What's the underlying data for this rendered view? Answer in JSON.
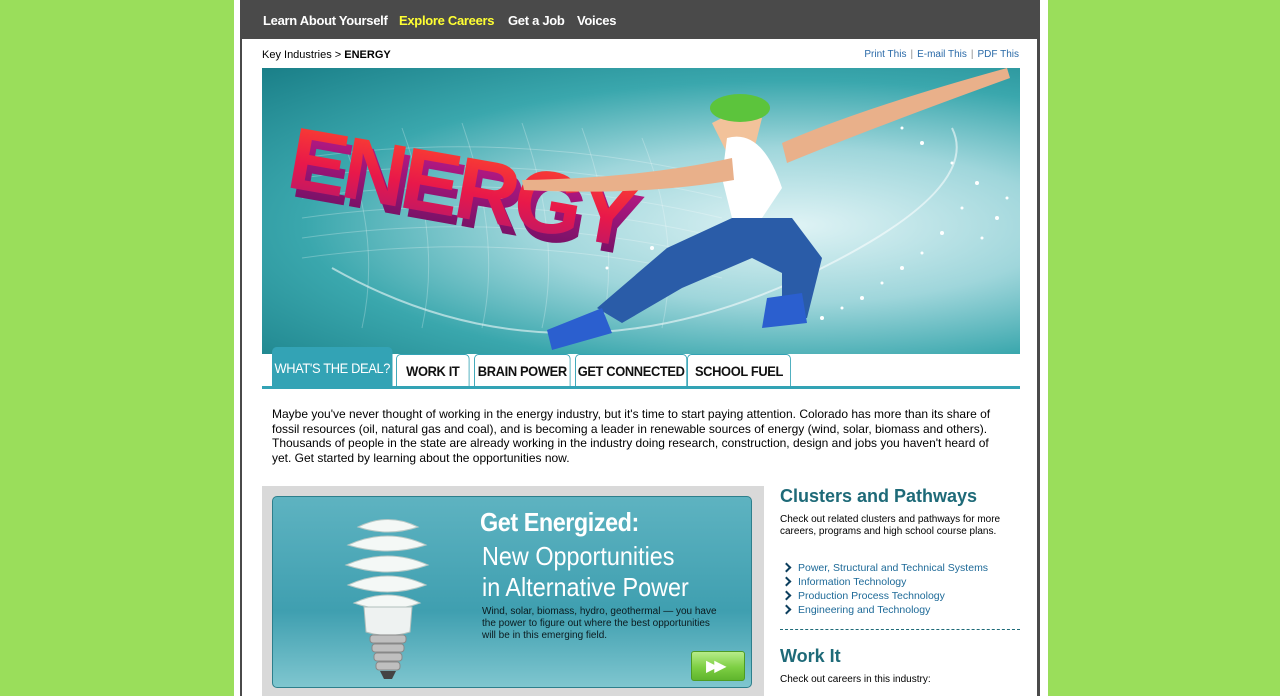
{
  "nav": {
    "items": [
      {
        "label": "Learn About Yourself",
        "active": false
      },
      {
        "label": "Explore Careers",
        "active": true
      },
      {
        "label": "Get a Job",
        "active": false
      },
      {
        "label": "Voices",
        "active": false
      }
    ]
  },
  "breadcrumb": {
    "parent": "Key Industries",
    "separator": ">",
    "current": "ENERGY"
  },
  "tools": {
    "print": "Print This",
    "email": "E-mail This",
    "pdf": "PDF This"
  },
  "hero": {
    "title_text": "ENERGY"
  },
  "tabs": [
    {
      "label": "WHAT'S THE DEAL?",
      "active": true
    },
    {
      "label": "WORK IT",
      "active": false
    },
    {
      "label": "BRAIN POWER",
      "active": false
    },
    {
      "label": "GET CONNECTED",
      "active": false
    },
    {
      "label": "SCHOOL FUEL",
      "active": false
    }
  ],
  "intro": "Maybe you've never thought of working in the energy industry, but it's time to start paying attention. Colorado has more than its share of fossil resources (oil, natural gas and coal), and is becoming a leader in renewable sources of energy (wind, solar, biomass and others). Thousands of people in the state are already working in the industry doing research, construction, design and jobs you haven't heard of yet. Get started by learning about the opportunities now.",
  "promo": {
    "title": "Get Energized:",
    "subtitle_line1": "New Opportunities",
    "subtitle_line2": "in Alternative Power",
    "body": "Wind, solar, biomass, hydro, geothermal — you have the power to figure out where the best opportunities will be in this emerging field.",
    "arrow": "▶▶"
  },
  "clusters": {
    "title": "Clusters and Pathways",
    "description": "Check out related clusters and pathways for more careers, programs and high school course plans.",
    "links": [
      "Power, Structural and Technical Systems",
      "Information Technology",
      "Production Process Technology",
      "Engineering and Technology"
    ]
  },
  "workit": {
    "title": "Work It",
    "description": "Check out careers in this industry:"
  },
  "colors": {
    "page_bg": "#9ade5b",
    "nav_bg": "#4a4a4a",
    "nav_active": "#ffff33",
    "accent_teal": "#33a3b5",
    "heading_teal": "#1e6a78",
    "link_blue": "#1e6a98"
  }
}
